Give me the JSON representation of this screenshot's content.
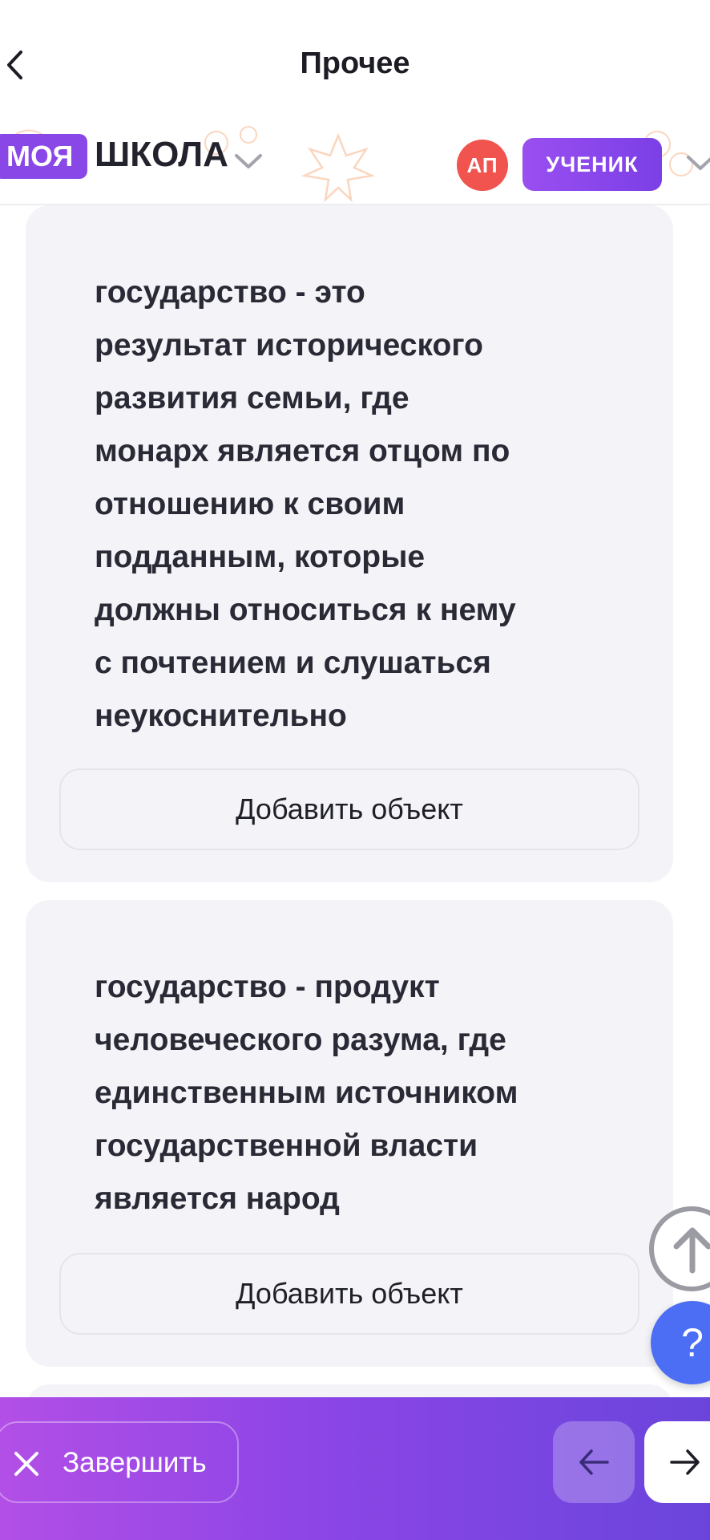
{
  "header": {
    "title": "Прочее"
  },
  "schoolbar": {
    "logo_badge": "МОЯ",
    "logo_text": "ШКОЛА",
    "avatar_initials": "АП",
    "role": "УЧЕНИК"
  },
  "cards": [
    {
      "text": "государство - это\nрезультат исторического\nразвития семьи, где\nмонарх является отцом по\nотношению к своим\nподданным, которые\nдолжны относиться к нему\nс почтением и слушаться\nнеукоснительно",
      "button_label": "Добавить объект"
    },
    {
      "text": "государство - продукт\nчеловеческого разума, где\nединственным источником\nгосударственной власти\nявляется народ",
      "button_label": "Добавить объект"
    }
  ],
  "help_label": "?",
  "footer": {
    "finish_label": "Завершить"
  },
  "colors": {
    "accent": "#8a47e8",
    "avatar": "#f1534f",
    "help": "#4b6ef5",
    "card_bg": "#f4f4f8"
  }
}
